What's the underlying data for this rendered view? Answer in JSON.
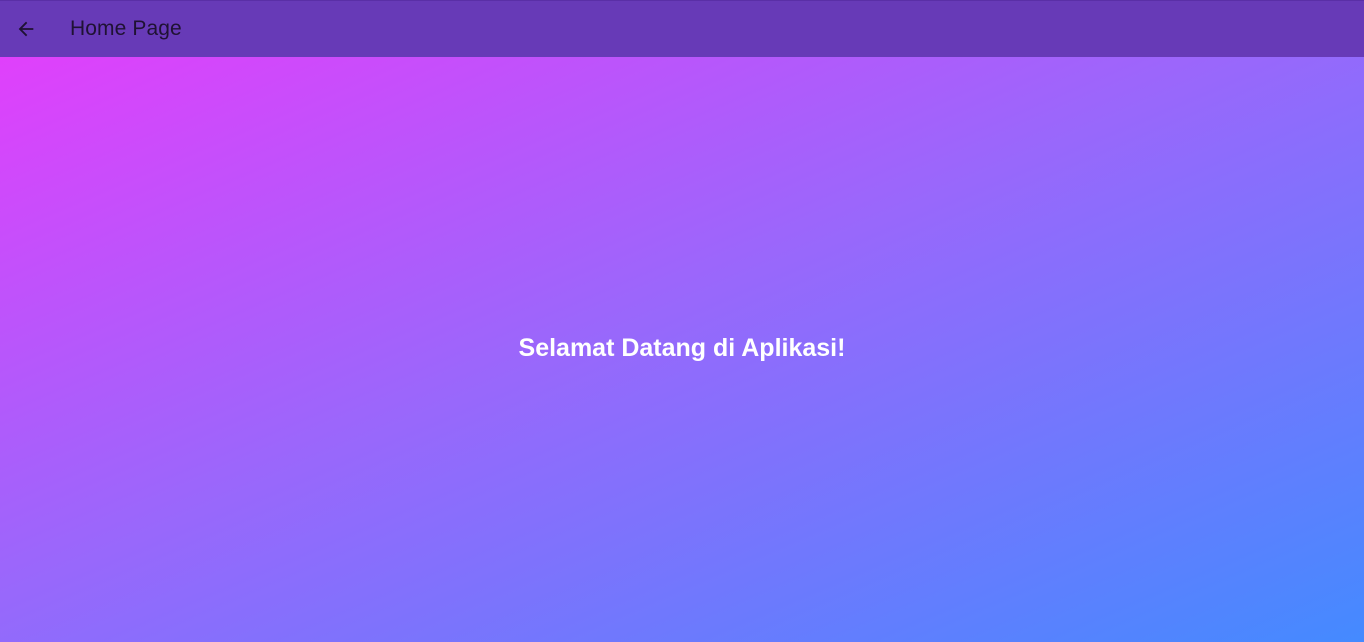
{
  "appbar": {
    "title": "Home Page",
    "back_icon": "arrow-back-icon",
    "background_color": "#673ab7"
  },
  "main": {
    "welcome_text": "Selamat Datang di Aplikasi!",
    "gradient_colors": [
      "#e040fb",
      "#448aff"
    ]
  }
}
